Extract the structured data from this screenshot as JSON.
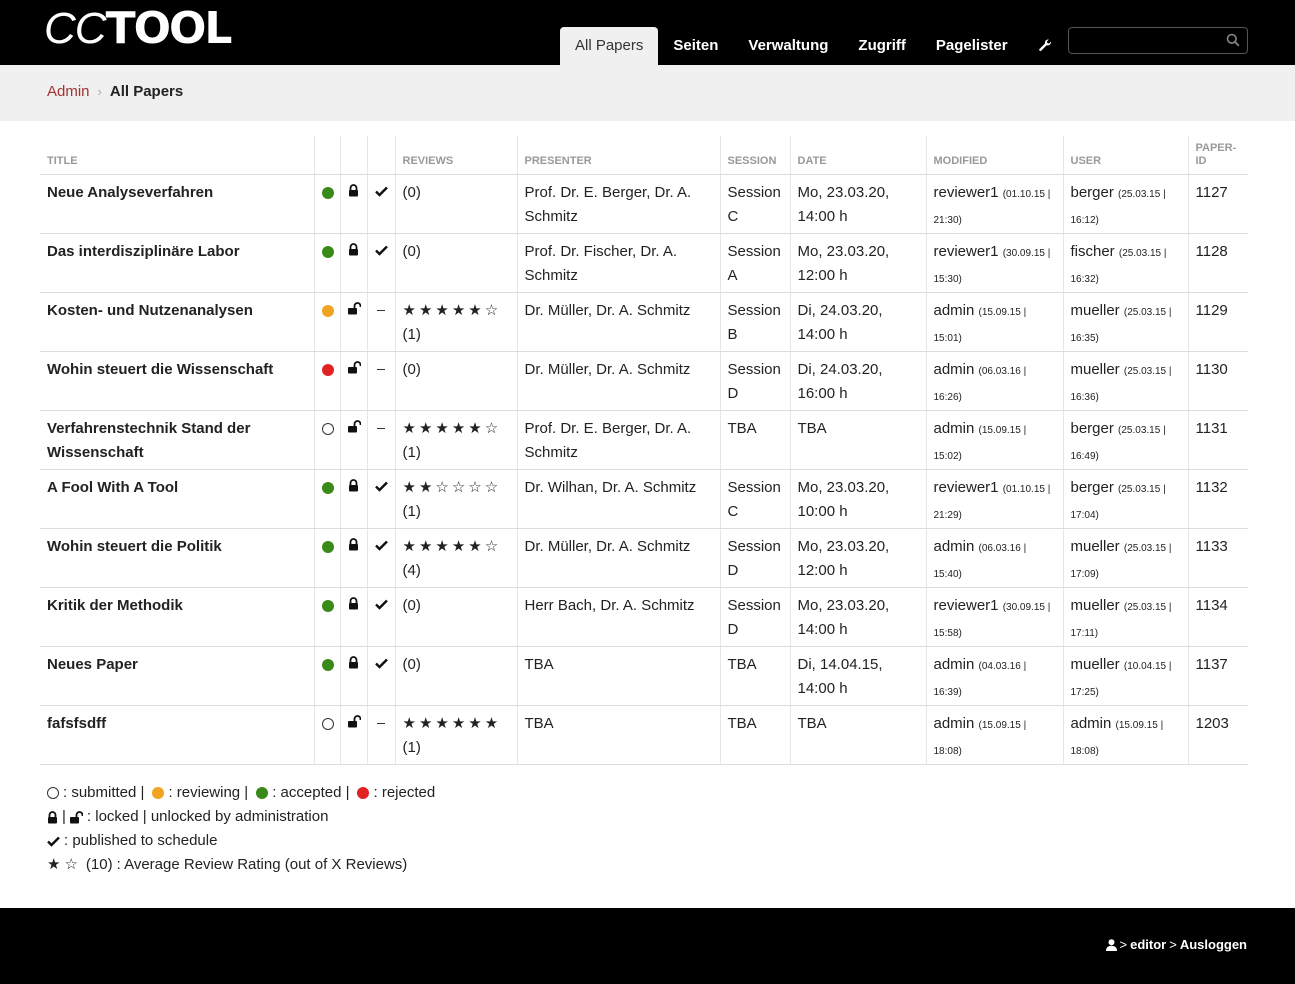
{
  "brand": {
    "logo_text_thin": "CC",
    "logo_text_bold": "TOOL"
  },
  "nav": {
    "items": [
      {
        "label": "All Papers",
        "active": true
      },
      {
        "label": "Seiten"
      },
      {
        "label": "Verwaltung"
      },
      {
        "label": "Zugriff"
      },
      {
        "label": "Pagelister"
      }
    ],
    "tool_icon": "wrench-icon"
  },
  "search": {
    "value": "",
    "placeholder": ""
  },
  "breadcrumb": {
    "parent": "Admin",
    "current": "All Papers"
  },
  "table": {
    "headers": [
      "TITLE",
      "",
      "",
      "",
      "REVIEWS",
      "PRESENTER",
      "SESSION",
      "DATE",
      "MODIFIED",
      "USER",
      "PAPER-ID"
    ],
    "rows": [
      {
        "title": "Neue Analyseverfahren",
        "status": "accepted",
        "lock": "locked",
        "published": true,
        "stars": "",
        "count": "(0)",
        "presenter": "Prof. Dr. E. Berger, Dr. A. Schmitz",
        "session": "Session C",
        "date": "Mo, 23.03.20, 14:00 h",
        "mod_user": "reviewer1",
        "mod_time": "(01.10.15 | 21:30)",
        "user": "berger",
        "user_time": "(25.03.15 | 16:12)",
        "id": "1127"
      },
      {
        "title": "Das interdisziplinäre Labor",
        "status": "accepted",
        "lock": "locked",
        "published": true,
        "stars": "",
        "count": "(0)",
        "presenter": "Prof. Dr. Fischer, Dr. A. Schmitz",
        "session": "Session A",
        "date": "Mo, 23.03.20, 12:00 h",
        "mod_user": "reviewer1",
        "mod_time": "(30.09.15 | 15:30)",
        "user": "fischer",
        "user_time": "(25.03.15 | 16:32)",
        "id": "1128"
      },
      {
        "title": "Kosten- und Nutzenanalysen",
        "status": "reviewing",
        "lock": "unlocked",
        "published": false,
        "stars": "★★★★★☆",
        "count": "(1)",
        "presenter": "Dr. Müller, Dr. A. Schmitz",
        "session": "Session B",
        "date": "Di, 24.03.20, 14:00 h",
        "mod_user": "admin",
        "mod_time": "(15.09.15 | 15:01)",
        "user": "mueller",
        "user_time": "(25.03.15 | 16:35)",
        "id": "1129"
      },
      {
        "title": "Wohin steuert die Wissenschaft",
        "status": "rejected",
        "lock": "unlocked",
        "published": false,
        "stars": "",
        "count": "(0)",
        "presenter": "Dr. Müller, Dr. A. Schmitz",
        "session": "Session D",
        "date": "Di, 24.03.20, 16:00 h",
        "mod_user": "admin",
        "mod_time": "(06.03.16 | 16:26)",
        "user": "mueller",
        "user_time": "(25.03.15 | 16:36)",
        "id": "1130"
      },
      {
        "title": "Verfahrenstechnik Stand der Wissenschaft",
        "status": "submitted",
        "lock": "unlocked",
        "published": false,
        "stars": "★★★★★☆",
        "count": "(1)",
        "presenter": "Prof. Dr. E. Berger, Dr. A. Schmitz",
        "session": "TBA",
        "date": "TBA",
        "mod_user": "admin",
        "mod_time": "(15.09.15 | 15:02)",
        "user": "berger",
        "user_time": "(25.03.15 | 16:49)",
        "id": "1131"
      },
      {
        "title": "A Fool With A Tool",
        "status": "accepted",
        "lock": "locked",
        "published": true,
        "stars": "★★☆☆☆☆",
        "count": "(1)",
        "presenter": "Dr. Wilhan, Dr. A. Schmitz",
        "session": "Session C",
        "date": "Mo, 23.03.20, 10:00 h",
        "mod_user": "reviewer1",
        "mod_time": "(01.10.15 | 21:29)",
        "user": "berger",
        "user_time": "(25.03.15 | 17:04)",
        "id": "1132"
      },
      {
        "title": "Wohin steuert die Politik",
        "status": "accepted",
        "lock": "locked",
        "published": true,
        "stars": "★★★★★☆",
        "count": "(4)",
        "presenter": "Dr. Müller, Dr. A. Schmitz",
        "session": "Session D",
        "date": "Mo, 23.03.20, 12:00 h",
        "mod_user": "admin",
        "mod_time": "(06.03.16 | 15:40)",
        "user": "mueller",
        "user_time": "(25.03.15 | 17:09)",
        "id": "1133"
      },
      {
        "title": "Kritik der Methodik",
        "status": "accepted",
        "lock": "locked",
        "published": true,
        "stars": "",
        "count": "(0)",
        "presenter": "Herr Bach, Dr. A. Schmitz",
        "session": "Session D",
        "date": "Mo, 23.03.20, 14:00 h",
        "mod_user": "reviewer1",
        "mod_time": "(30.09.15 | 15:58)",
        "user": "mueller",
        "user_time": "(25.03.15 | 17:11)",
        "id": "1134"
      },
      {
        "title": "Neues Paper",
        "status": "accepted",
        "lock": "locked",
        "published": true,
        "stars": "",
        "count": "(0)",
        "presenter": "TBA",
        "session": "TBA",
        "date": "Di, 14.04.15, 14:00 h",
        "mod_user": "admin",
        "mod_time": "(04.03.16 | 16:39)",
        "user": "mueller",
        "user_time": "(10.04.15 | 17:25)",
        "id": "1137"
      },
      {
        "title": "fafsfsdff",
        "status": "submitted",
        "lock": "unlocked",
        "published": false,
        "stars": "★★★★★★",
        "count": "(1)",
        "presenter": "TBA",
        "session": "TBA",
        "date": "TBA",
        "mod_user": "admin",
        "mod_time": "(15.09.15 | 18:08)",
        "user": "admin",
        "user_time": "(15.09.15 | 18:08)",
        "id": "1203"
      }
    ]
  },
  "legend": {
    "submitted": ": submitted |",
    "reviewing": ": reviewing |",
    "accepted": ": accepted |",
    "rejected": ": rejected",
    "lock_sep": "|",
    "lock_text": ": locked | unlocked by administration",
    "published_text": ": published to schedule",
    "rating_count": "(10)",
    "rating_text": ": Average Review Rating (out of X Reviews)"
  },
  "footer": {
    "user_icon": "user-icon",
    "username": "editor",
    "logout": "Ausloggen",
    "chevron": ">"
  },
  "colors": {
    "accent": "#a23333",
    "accepted": "#3a8a1a",
    "reviewing": "#f0a420",
    "rejected": "#e02222"
  }
}
